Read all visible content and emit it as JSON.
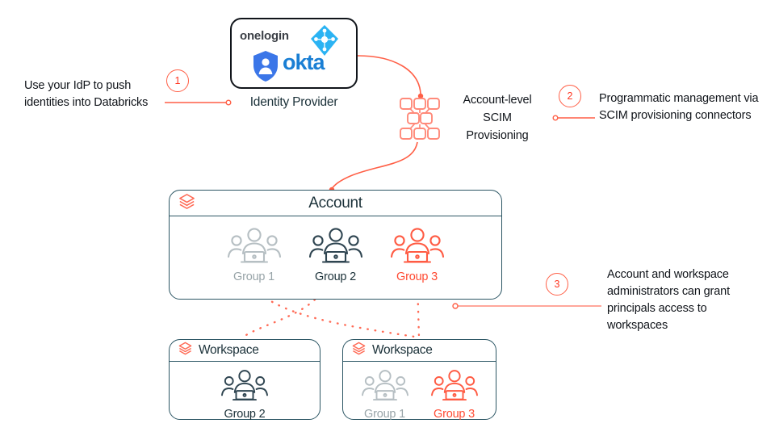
{
  "diagram": {
    "title": "Databricks identity provisioning overview",
    "colors": {
      "coral": "#FF3621",
      "coral_light": "#FF8A7A",
      "navy": "#1B3139",
      "teal_border": "#2C5664",
      "grey": "#98A4A8",
      "okta_blue": "#1A7FD4",
      "azure_blue": "#2BB3F3"
    }
  },
  "idp": {
    "onelogin_label": "onelogin",
    "okta_label": "okta",
    "azure_icon_name": "azure-active-directory-icon",
    "entra_icon_name": "entra-shield-user-icon",
    "caption": "Identity Provider"
  },
  "callouts": [
    {
      "number": "1",
      "text": "Use your IdP to push identities into Databricks"
    },
    {
      "number": "2",
      "text": "Programmatic management via SCIM provisioning connectors"
    },
    {
      "number": "3",
      "text": "Account and workspace administrators can grant principals access to workspaces"
    }
  ],
  "scim": {
    "icon_name": "scim-network-mesh-icon",
    "caption_line1": "Account-level",
    "caption_line2": "SCIM",
    "caption_line3": "Provisioning",
    "caption_full": "Account-level SCIM Provisioning"
  },
  "account": {
    "title": "Account",
    "logo_name": "databricks-stack-logo",
    "groups": [
      {
        "label": "Group 1",
        "tone": "grey"
      },
      {
        "label": "Group 2",
        "tone": "dark"
      },
      {
        "label": "Group 3",
        "tone": "coral"
      }
    ]
  },
  "workspaces": [
    {
      "title": "Workspace",
      "logo_name": "databricks-stack-logo",
      "groups": [
        {
          "label": "Group 2",
          "tone": "dark"
        }
      ]
    },
    {
      "title": "Workspace",
      "logo_name": "databricks-stack-logo",
      "groups": [
        {
          "label": "Group 1",
          "tone": "grey"
        },
        {
          "label": "Group 3",
          "tone": "coral"
        }
      ]
    }
  ]
}
